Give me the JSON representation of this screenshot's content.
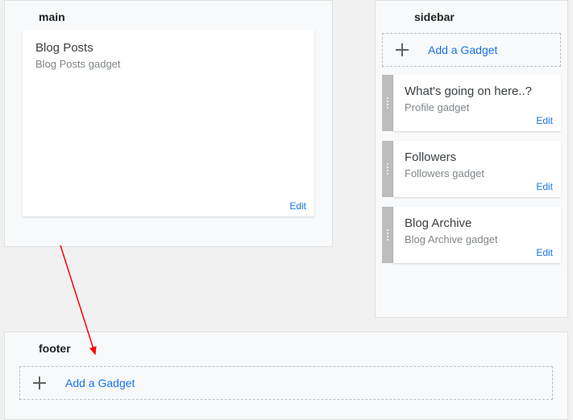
{
  "sections": {
    "main": {
      "title": "main"
    },
    "sidebar": {
      "title": "sidebar"
    },
    "footer": {
      "title": "footer"
    }
  },
  "main_gadget": {
    "title": "Blog Posts",
    "subtitle": "Blog Posts gadget",
    "edit": "Edit"
  },
  "sidebar_add": {
    "label": "Add a Gadget"
  },
  "sidebar_gadgets": [
    {
      "title": "What's going on here..?",
      "subtitle": "Profile gadget",
      "edit": "Edit"
    },
    {
      "title": "Followers",
      "subtitle": "Followers gadget",
      "edit": "Edit"
    },
    {
      "title": "Blog Archive",
      "subtitle": "Blog Archive gadget",
      "edit": "Edit"
    }
  ],
  "footer_add": {
    "label": "Add a Gadget"
  }
}
